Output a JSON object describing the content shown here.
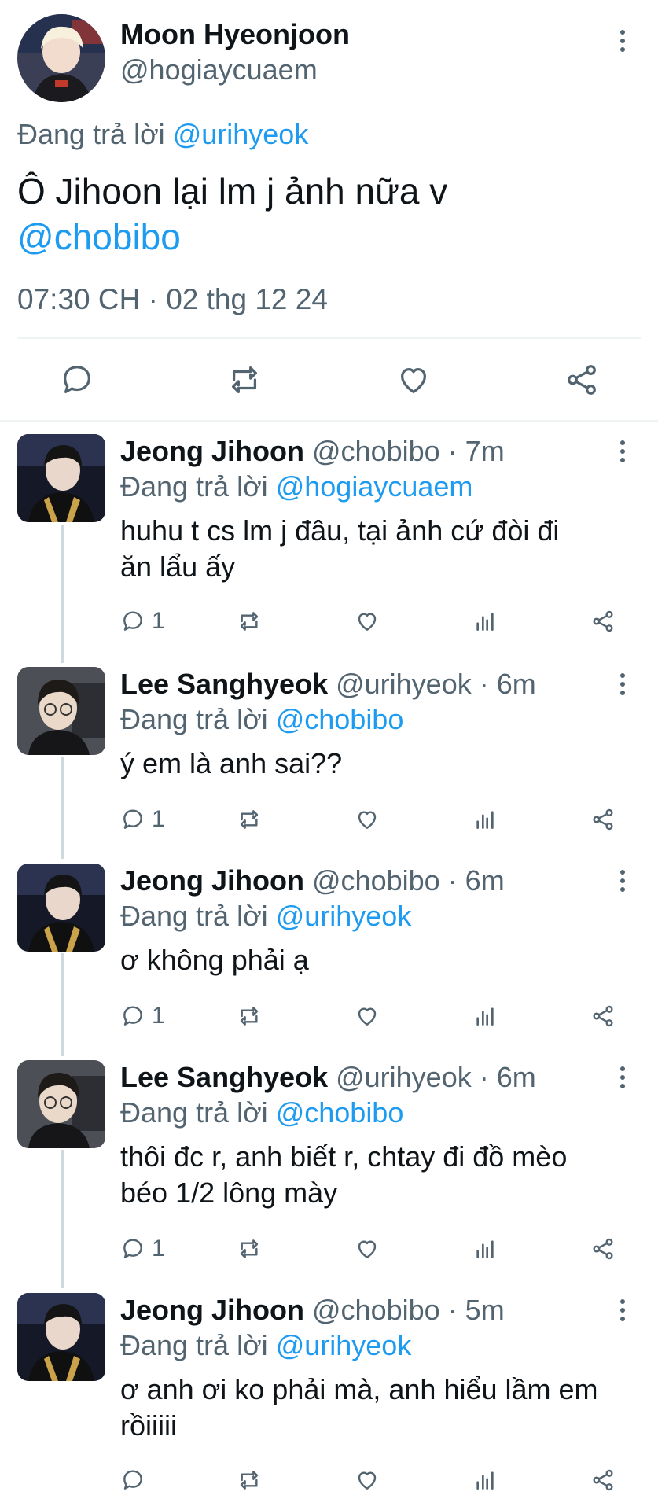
{
  "main_tweet": {
    "author_name": "Moon Hyeonjoon",
    "handle": "@hogiaycuaem",
    "replying_prefix": "Đang trả lời",
    "replying_to": "@urihyeok",
    "text_line1": "Ô Jihoon lại lm j ảnh nữa v",
    "mention": "@chobibo",
    "timestamp": "07:30 CH · 02 thg 12 24",
    "icons": [
      "reply-icon",
      "retweet-icon",
      "like-icon",
      "share-icon"
    ]
  },
  "replies": [
    {
      "name": "Jeong Jihoon",
      "handle": "@chobibo",
      "time": "· 7m",
      "replying_prefix": "Đang trả lời",
      "replying_to": "@hogiaycuaem",
      "text_line1": "huhu t cs lm j đâu, tại ảnh cứ đòi đi",
      "text_line2": "ăn lẩu ấy",
      "reply_count": "1"
    },
    {
      "name": "Lee Sanghyeok",
      "handle": "@urihyeok",
      "time": "· 6m",
      "replying_prefix": "Đang trả lời",
      "replying_to": "@chobibo",
      "text_line1": "ý em là anh sai??",
      "text_line2": "",
      "reply_count": "1"
    },
    {
      "name": "Jeong Jihoon",
      "handle": "@chobibo",
      "time": "· 6m",
      "replying_prefix": "Đang trả lời",
      "replying_to": "@urihyeok",
      "text_line1": "ơ không phải ạ",
      "text_line2": "",
      "reply_count": "1"
    },
    {
      "name": "Lee Sanghyeok",
      "handle": "@urihyeok",
      "time": "· 6m",
      "replying_prefix": "Đang trả lời",
      "replying_to": "@chobibo",
      "text_line1": "thôi đc r, anh biết r, chtay đi đồ mèo",
      "text_line2": "béo 1/2 lông mày",
      "reply_count": "1"
    },
    {
      "name": "Jeong Jihoon",
      "handle": "@chobibo",
      "time": "· 5m",
      "replying_prefix": "Đang trả lời",
      "replying_to": "@urihyeok",
      "text_line1": "ơ anh ơi ko phải mà, anh hiểu lầm em",
      "text_line2": "rồiiiii",
      "reply_count": ""
    }
  ],
  "colors": {
    "link": "#1d9bf0",
    "secondary_text": "#536471",
    "divider": "#eff3f4",
    "thread_line": "#cfd9de"
  }
}
